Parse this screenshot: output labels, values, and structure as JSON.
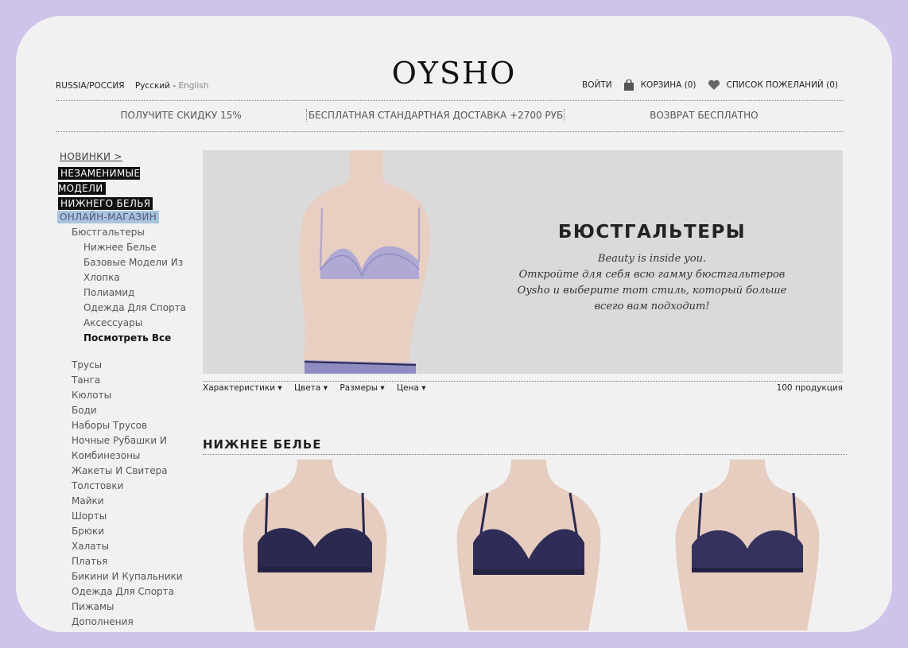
{
  "brand": {
    "logo": "OYSHO"
  },
  "locale": {
    "country": "RUSSIA/РОССИЯ",
    "lang_ru": "Русский",
    "sep": " - ",
    "lang_en": "English"
  },
  "account": {
    "login": "ВОЙТИ",
    "cart": "КОРЗИНА (0)",
    "wishlist": "СПИСОК ПОЖЕЛАНИЙ (0)"
  },
  "promos": [
    "ПОЛУЧИТЕ СКИДКУ 15%",
    "БЕСПЛАТНАЯ СТАНДАРТНАЯ ДОСТАВКА +2700 РУБ",
    "ВОЗВРАТ БЕСПЛАТНО"
  ],
  "sidebar": {
    "new_link": "НОВИНКИ >",
    "essential": [
      "НЕЗАМЕНИМЫЕ МОДЕЛИ",
      "НИЖНЕГО БЕЛЬЯ"
    ],
    "shop": "ОНЛАЙН-МАГАЗИН",
    "category": "Бюстгальтеры",
    "subcategories": [
      "Нижнее Белье",
      "Базовые Модели Из",
      "Хлопка",
      "Полиамид",
      "Одежда Для Спорта",
      "Аксессуары",
      "Посмотреть Все"
    ],
    "categories": [
      "Трусы",
      "Танга",
      "Кюлоты",
      "Боди",
      "Наборы Трусов",
      "Ночные Рубашки И",
      "Комбинезоны",
      "Жакеты И Свитера",
      "Толстовки",
      "Майки",
      "Шорты",
      "Брюки",
      "Халаты",
      "Платья",
      "Бикини И Купальники",
      "Одежда Для Спорта",
      "Пижамы",
      "Дополнения"
    ]
  },
  "banner": {
    "title": "БЮСТГАЛЬТЕРЫ",
    "lines": [
      "Beauty is inside you.",
      "Откройте для себя всю гамму бюстгальтеров",
      "Oysho и выберите тот стиль, который больше",
      "всего вам подходит!"
    ]
  },
  "filters": {
    "items": [
      "Характеристики",
      "Цвета",
      "Размеры",
      "Цена"
    ],
    "count": "100 продукция"
  },
  "section": {
    "title": "НИЖНЕЕ БЕЛЬЕ"
  },
  "colors": {
    "background": "#cfc3ea",
    "page": "#f1f1f1",
    "banner": "#d8d8d8",
    "bra_lavender": "#9a98d0",
    "bra_navy": "#2b2950",
    "skin": "#e7cfc2"
  }
}
